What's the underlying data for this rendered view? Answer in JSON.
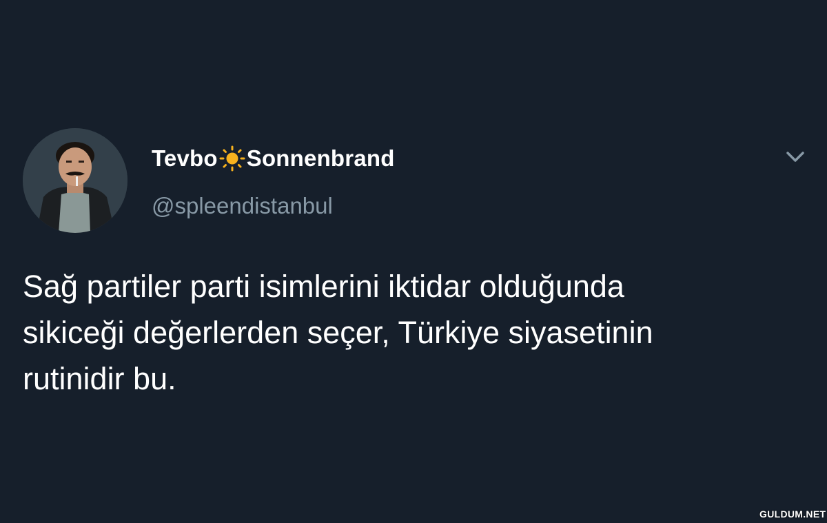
{
  "tweet": {
    "author": {
      "name_part1": "Tevbo",
      "name_emoji": "sun-icon",
      "name_part2": "Sonnenbrand",
      "handle": "@spleendistanbul",
      "avatar": "profile-photo"
    },
    "text": "Sağ partiler parti isimlerini iktidar olduğunda\nsikiceği değerlerden seçer, Türkiye siyasetinin\nrutinidir bu.",
    "menu_icon": "chevron-down-icon"
  },
  "watermark": "GULDUM.NET",
  "colors": {
    "background": "#161f2b",
    "text_primary": "#ffffff",
    "text_secondary": "#8899a6",
    "sun": "#f7b21e"
  }
}
